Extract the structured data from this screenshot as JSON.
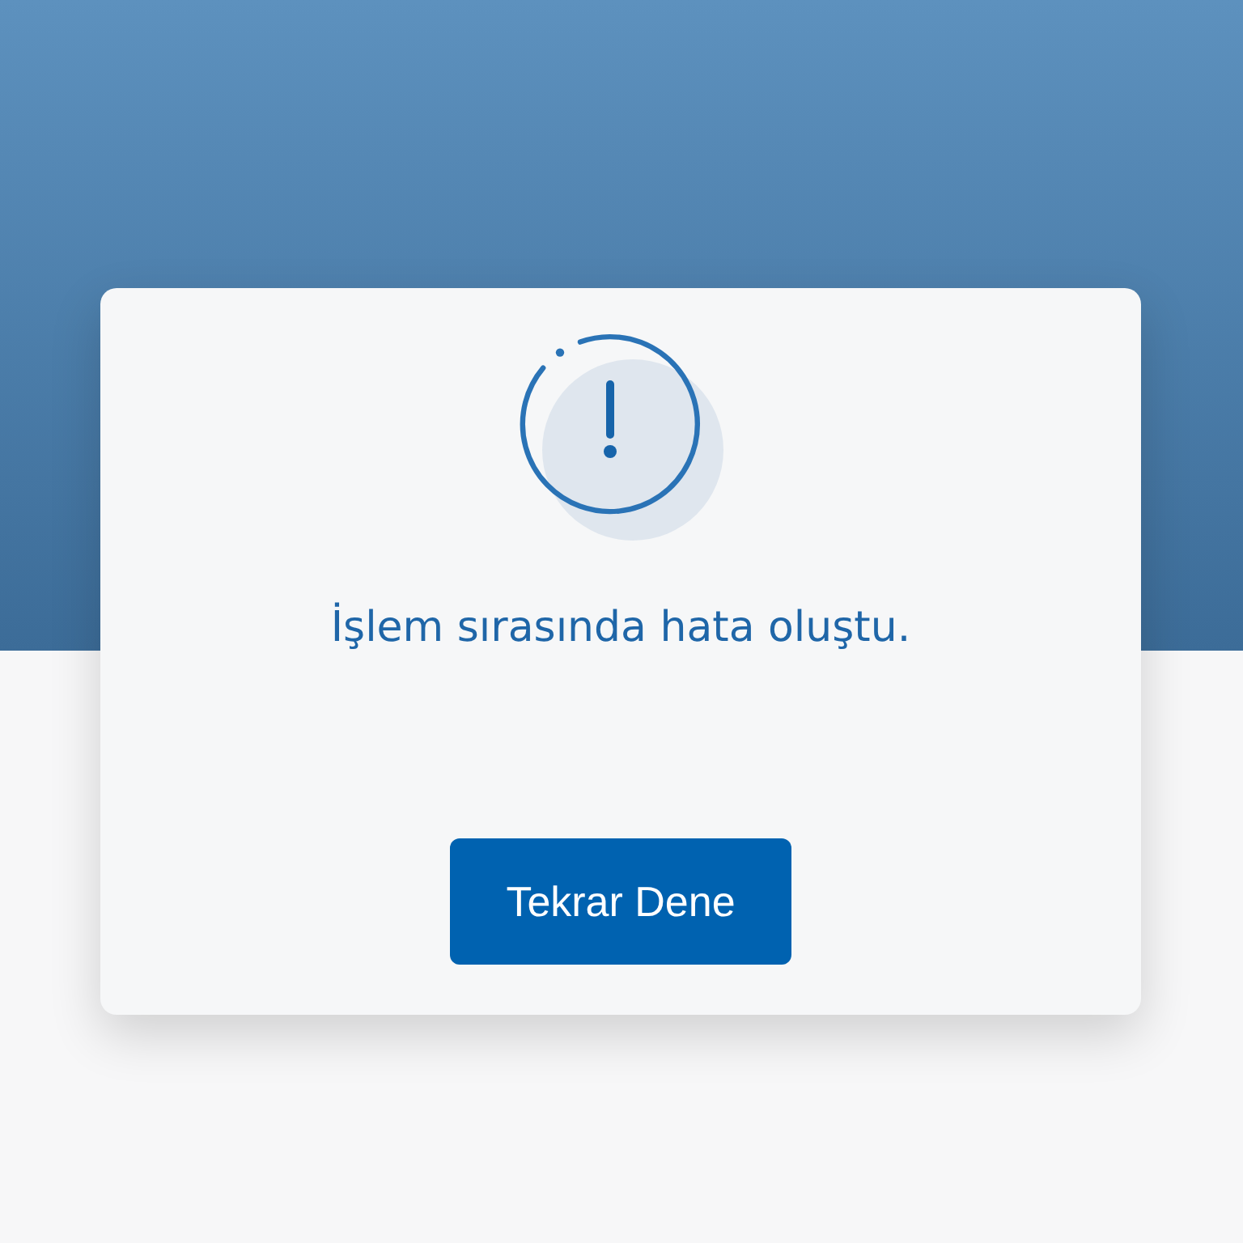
{
  "dialog": {
    "message": "İşlem sırasında hata oluştu.",
    "retry_button": {
      "label": "Tekrar Dene"
    }
  }
}
